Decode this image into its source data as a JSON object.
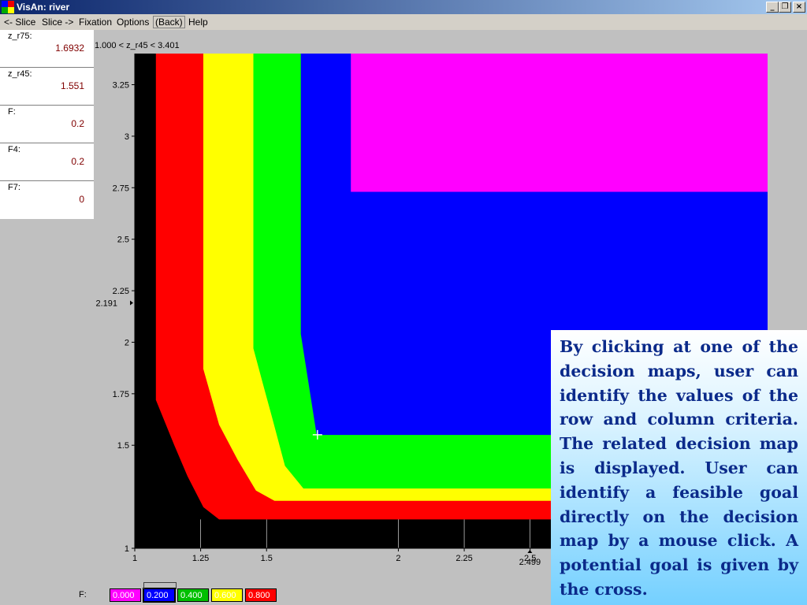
{
  "window": {
    "title": "VisAn: river",
    "controls": [
      "_",
      "❐",
      "×"
    ]
  },
  "menu": {
    "items": [
      "<- Slice",
      "Slice ->",
      "Fixation",
      "Options",
      "(Back)",
      "Help"
    ]
  },
  "params": [
    {
      "name": "z_r75:",
      "value": "1.6932"
    },
    {
      "name": "z_r45:",
      "value": "1.551"
    },
    {
      "name": "F:",
      "value": "0.2"
    },
    {
      "name": "F4:",
      "value": "0.2"
    },
    {
      "name": "F7:",
      "value": "0"
    }
  ],
  "range_label": "1.000 < z_r45 < 3.401",
  "chart_data": {
    "type": "heatmap",
    "title": "",
    "xlabel": "",
    "ylabel": "",
    "xlim": [
      1,
      3.401
    ],
    "ylim": [
      1,
      3.401
    ],
    "x_ticks": [
      "1",
      "1.25",
      "1.5",
      "2",
      "2.25",
      "2.5"
    ],
    "x_tick_values": [
      1,
      1.25,
      1.5,
      2,
      2.25,
      2.5
    ],
    "y_ticks": [
      "3.25",
      "3",
      "2.75",
      "2.5",
      "2.25",
      "2",
      "1.75",
      "1.5",
      "1"
    ],
    "y_tick_values": [
      3.25,
      3,
      2.75,
      2.5,
      2.25,
      2,
      1.75,
      1.5,
      1
    ],
    "background_color": "#000000",
    "regions": [
      {
        "name": "F 0.800",
        "color": "#ff0000",
        "boundary": [
          [
            1.08,
            3.401
          ],
          [
            1.08,
            1.72
          ],
          [
            1.15,
            1.5
          ],
          [
            1.2,
            1.35
          ],
          [
            1.26,
            1.2
          ],
          [
            1.32,
            1.14
          ],
          [
            3.401,
            1.14
          ],
          [
            3.401,
            3.401
          ]
        ]
      },
      {
        "name": "F 0.600",
        "color": "#ffff00",
        "boundary": [
          [
            1.26,
            3.401
          ],
          [
            1.26,
            1.87
          ],
          [
            1.32,
            1.6
          ],
          [
            1.39,
            1.43
          ],
          [
            1.46,
            1.28
          ],
          [
            1.53,
            1.23
          ],
          [
            3.401,
            1.23
          ],
          [
            3.401,
            3.401
          ]
        ]
      },
      {
        "name": "F 0.400",
        "color": "#00ff00",
        "boundary": [
          [
            1.45,
            3.401
          ],
          [
            1.45,
            1.97
          ],
          [
            1.49,
            1.78
          ],
          [
            1.52,
            1.64
          ],
          [
            1.57,
            1.4
          ],
          [
            1.64,
            1.29
          ],
          [
            3.401,
            1.29
          ],
          [
            3.401,
            3.401
          ]
        ]
      },
      {
        "name": "F 0.200",
        "color": "#0000ff",
        "boundary": [
          [
            1.63,
            3.401
          ],
          [
            1.63,
            2.04
          ],
          [
            1.69,
            1.55
          ],
          [
            3.401,
            1.55
          ],
          [
            3.401,
            3.401
          ]
        ]
      },
      {
        "name": "F 0.000",
        "color": "#ff00ff",
        "boundary": [
          [
            1.82,
            3.401
          ],
          [
            1.82,
            2.73
          ],
          [
            3.401,
            2.73
          ],
          [
            3.401,
            3.401
          ]
        ]
      }
    ],
    "cursor": {
      "x": 1.6932,
      "y": 1.551
    },
    "markers": {
      "x_value": "2.499",
      "y_value": "2.191"
    }
  },
  "legend": {
    "title": "F:",
    "items": [
      {
        "label": "0.000",
        "color": "#ff00ff"
      },
      {
        "label": "0.200",
        "color": "#0000ff",
        "selected": true
      },
      {
        "label": "0.400",
        "color": "#00c000"
      },
      {
        "label": "0.600",
        "color": "#ffff00"
      },
      {
        "label": "0.800",
        "color": "#ff0000"
      }
    ]
  },
  "caption": "By clicking at one of the decision maps, user can identify the values of the row and column criteria. The related decision map is displayed. User can identify a feasible goal directly on the decision map by a mouse click. A potential goal is given by the cross."
}
